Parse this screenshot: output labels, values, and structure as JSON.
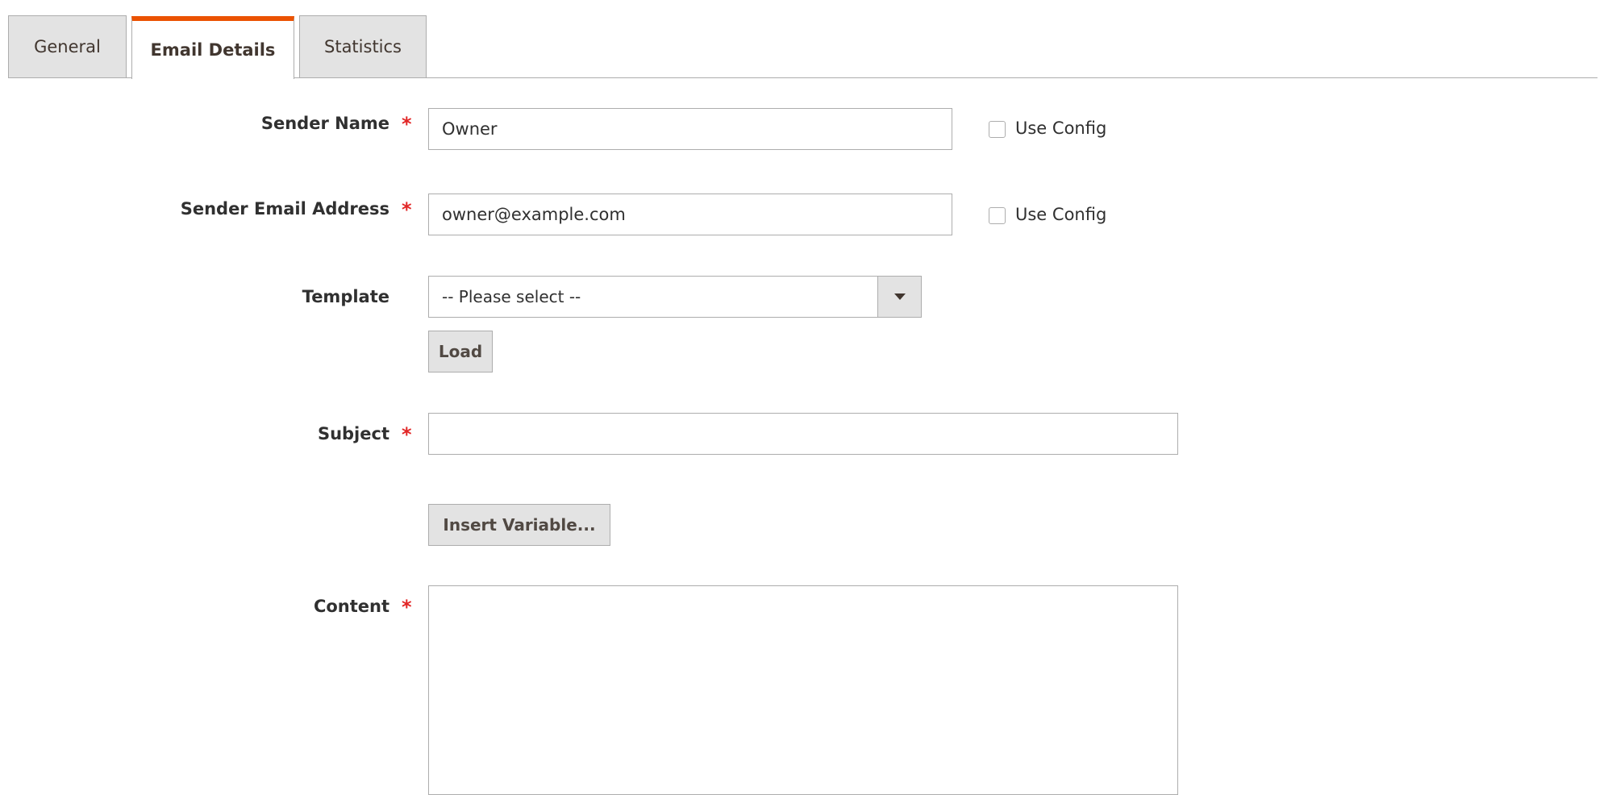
{
  "tabs": [
    {
      "label": "General",
      "active": false
    },
    {
      "label": "Email Details",
      "active": true
    },
    {
      "label": "Statistics",
      "active": false
    }
  ],
  "accent_color": "#eb5202",
  "required_color": "#e22626",
  "form": {
    "sender_name": {
      "label": "Sender Name",
      "required_mark": "*",
      "value": "Owner",
      "use_config_label": "Use Config",
      "use_config_checked": false
    },
    "sender_email": {
      "label": "Sender Email Address",
      "required_mark": "*",
      "value": "owner@example.com",
      "use_config_label": "Use Config",
      "use_config_checked": false
    },
    "template": {
      "label": "Template",
      "selected": "-- Please select --",
      "load_button": "Load"
    },
    "subject": {
      "label": "Subject",
      "required_mark": "*",
      "value": ""
    },
    "insert_variable_button": "Insert Variable...",
    "content": {
      "label": "Content",
      "required_mark": "*",
      "value": ""
    }
  }
}
